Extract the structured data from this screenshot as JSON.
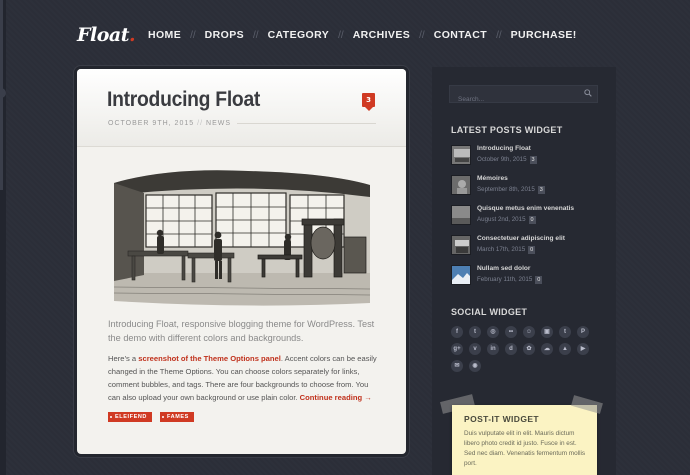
{
  "site": {
    "logo": "Float",
    "logo_dot": "."
  },
  "nav": [
    {
      "label": "HOME"
    },
    {
      "label": "DROPS"
    },
    {
      "label": "CATEGORY"
    },
    {
      "label": "ARCHIVES"
    },
    {
      "label": "CONTACT"
    },
    {
      "label": "PURCHASE!"
    }
  ],
  "post": {
    "title": "Introducing Float",
    "comment_count": "3",
    "date": "OCTOBER 9TH, 2015",
    "category": "NEWS",
    "lead": "Introducing Float, responsive blogging theme for WordPress. Test the demo with different colors and backgrounds.",
    "body_1": "Here’s a ",
    "body_link": "screenshot of the Theme Options panel",
    "body_2": ". Accent colors can be easily changed in the Theme Options. You can choose colors separately for links, comment bubbles, and tags. There are four backgrounds to choose from. You can also upload your own background or use plain color. ",
    "continue": "Continue reading →",
    "tags": [
      "ELEIFEND",
      "FAMES"
    ]
  },
  "sidebar": {
    "search_placeholder": "Search...",
    "latest_title": "LATEST POSTS WIDGET",
    "latest": [
      {
        "title": "Introducing Float",
        "date": "October 9th, 2015",
        "count": "3"
      },
      {
        "title": "Mémoires",
        "date": "September 8th, 2015",
        "count": "3"
      },
      {
        "title": "Quisque metus enim venenatis",
        "date": "August 2nd, 2015",
        "count": "0"
      },
      {
        "title": "Consectetuer adipiscing elit",
        "date": "March 17th, 2015",
        "count": "0"
      },
      {
        "title": "Nullam sed dolor",
        "date": "February 11th, 2015",
        "count": "0"
      }
    ],
    "social_title": "SOCIAL WIDGET",
    "social_icons": [
      "facebook-icon",
      "twitter-icon",
      "dribbble-icon",
      "flickr-icon",
      "github-icon",
      "instagram-icon",
      "tumblr-icon",
      "pinterest-icon",
      "google-plus-icon",
      "vimeo-icon",
      "linkedin-icon",
      "deviantart-icon",
      "picasa-icon",
      "soundcloud-icon",
      "forrst-icon",
      "youtube-icon",
      "email-icon",
      "rss-icon"
    ],
    "postit_title": "POST-IT WIDGET",
    "postit_text": "Duis vulputate elit in elit. Mauris dictum libero photo credit id justo. Fusce in est. Sed nec diam. Venenatis fermentum mollis port."
  },
  "colors": {
    "accent": "#d03a23",
    "background": "#2b2e38",
    "card": "#f3f2ee",
    "postit": "#fbf3c3"
  }
}
